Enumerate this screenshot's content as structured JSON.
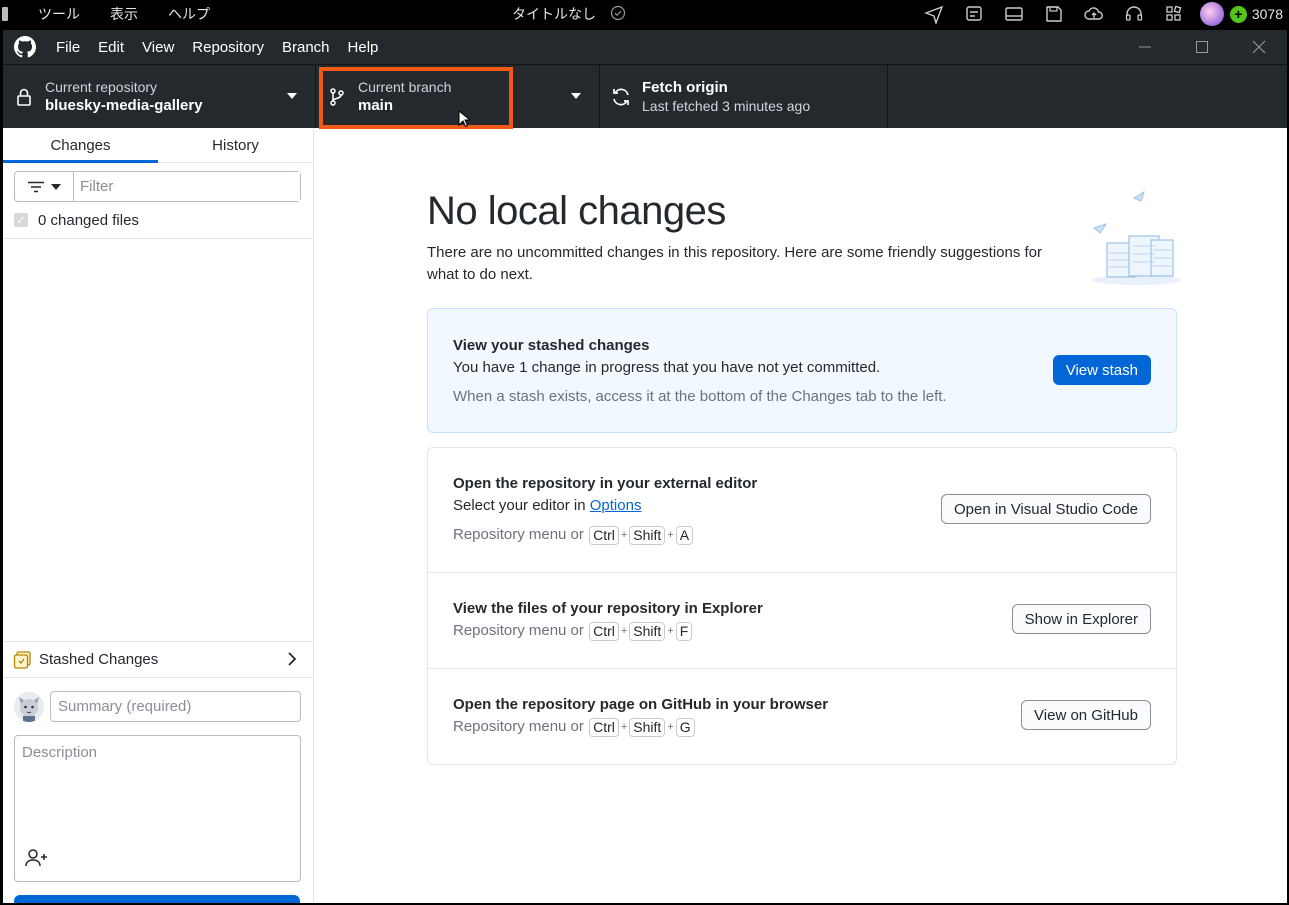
{
  "os_bar": {
    "menu": [
      "ツール",
      "表示",
      "ヘルプ"
    ],
    "title": "タイトルなし",
    "coin_count": "3078"
  },
  "window": {
    "menu": [
      "File",
      "Edit",
      "View",
      "Repository",
      "Branch",
      "Help"
    ]
  },
  "toolbar": {
    "repo_label": "Current repository",
    "repo_value": "bluesky-media-gallery",
    "branch_label": "Current branch",
    "branch_value": "main",
    "fetch_label": "Fetch origin",
    "fetch_value": "Last fetched 3 minutes ago"
  },
  "sidebar": {
    "tabs": [
      "Changes",
      "History"
    ],
    "filter_placeholder": "Filter",
    "changed_files": "0 changed files",
    "stashed_changes": "Stashed Changes",
    "summary_placeholder": "Summary (required)",
    "description_placeholder": "Description"
  },
  "main": {
    "heading": "No local changes",
    "subtext": "There are no uncommitted changes in this repository. Here are some friendly suggestions for what to do next.",
    "stash": {
      "title": "View your stashed changes",
      "desc": "You have 1 change in progress that you have not yet committed.",
      "hint": "When a stash exists, access it at the bottom of the Changes tab to the left.",
      "button": "View stash"
    },
    "editor": {
      "title": "Open the repository in your external editor",
      "desc_prefix": "Select your editor in ",
      "desc_link": "Options",
      "hint_prefix": "Repository menu or",
      "keys": [
        "Ctrl",
        "Shift",
        "A"
      ],
      "button": "Open in Visual Studio Code"
    },
    "explorer": {
      "title": "View the files of your repository in Explorer",
      "hint_prefix": "Repository menu or",
      "keys": [
        "Ctrl",
        "Shift",
        "F"
      ],
      "button": "Show in Explorer"
    },
    "github": {
      "title": "Open the repository page on GitHub in your browser",
      "hint_prefix": "Repository menu or",
      "keys": [
        "Ctrl",
        "Shift",
        "G"
      ],
      "button": "View on GitHub"
    }
  },
  "colors": {
    "accent": "#0366d6",
    "highlight": "#f05a14",
    "toolbar_bg": "#24292e"
  }
}
